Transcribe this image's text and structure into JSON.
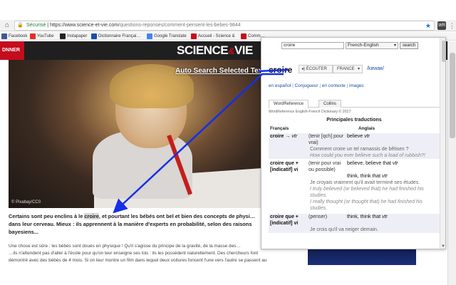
{
  "browser": {
    "url_secure_label": "Sécurisé",
    "url_prefix": "https://www.science-et-vie.com",
    "url_rest": "/questions-reponses/comment-pensent-les-bebes-9844",
    "extension_label": "WR",
    "bookmarks": [
      {
        "label": "Facebook",
        "color": "#3b5998"
      },
      {
        "label": "YouTube",
        "color": "#e52d27"
      },
      {
        "label": "Instapaper",
        "color": "#222222"
      },
      {
        "label": "Dictionnaire Françai…",
        "color": "#1a4fa8"
      },
      {
        "label": "Google Translate",
        "color": "#4285f4"
      },
      {
        "label": "Accueil - Science &",
        "color": "#c40d1e"
      },
      {
        "label": "Comm…",
        "color": "#c40d1e"
      }
    ]
  },
  "page": {
    "subscribe_label": "DNNER",
    "logo_main": "SCIENCE",
    "logo_amp": "&",
    "logo_end": "VIE",
    "photo_overlay": "Auto Search Selected Text",
    "photo_credit": "© Pixabay/CC0",
    "lead_before": "Certains sont peu enclins à le ",
    "lead_highlight": "croire",
    "lead_after": ", et pourtant les bébés ont bel et bien des concepts de physi… dans leur cerveau. Mieux : ils apprennent à la manière d'experts en probabilité, selon des raisons bayesiens...",
    "body_line1": "Une chose est sûre : les bébés sont doués en physique ! Qu'il s'agisse du principe de la gravité, de la masse des…",
    "body_line2": "…ils n'attendent pas d'aller à l'école pour qu'on leur enseigne ses lois : ils les possèdent naturellement. Des chercheurs font",
    "body_line3": "démontré avec des bébés de 4 mois. Si on leur montre un film dans lequel deux voitures foncent l'une vers l'autre se passent au"
  },
  "popup": {
    "search_value": "croire",
    "language_select": "French-English",
    "search_button": "search",
    "headword": "croire",
    "listen_label": "◂) ÉCOUTER",
    "country_select": "FRANCE",
    "phonetic": "/kʀwaʀ/",
    "links": [
      "en español",
      "Conjugueur",
      "en contexte",
      "images"
    ],
    "tabs": [
      "WordReference",
      "Collins"
    ],
    "dict_title": "WordReference English-French Dictionary © 2017:",
    "section_title": "Principales traductions",
    "col_fr": "Français",
    "col_en": "Anglais",
    "entries": [
      {
        "fr": "croire",
        "pos": "vtr",
        "note": "(tenir [qch] pour vrai)",
        "en": "believe",
        "en_pos": "vtr",
        "ex_fr": "Comment croire un tel ramassis de bêtises ?",
        "ex_en": "How could you ever believe such a load of rubbish?!"
      },
      {
        "fr": "croire que +",
        "pos": "[indicatif] vi",
        "note": "(tenir pour vrai ou possible)",
        "en": "believe, believe that",
        "en_pos": "vtr",
        "en2": "think, think that",
        "en2_pos": "vtr",
        "ex_fr": "Je croyais vraiment qu'il avait terminé ses études.",
        "ex_en": "I truly believed (or believed that) he had finished his studies.",
        "ex_en2": "I really thought (or thought that) he had finished his studies."
      },
      {
        "fr": "croire que +",
        "pos": "[indicatif] vi",
        "note": "(penser)",
        "en": "think, think that",
        "en_pos": "vtr",
        "ex_fr": "Je crois qu'il va neiger demain."
      }
    ]
  }
}
